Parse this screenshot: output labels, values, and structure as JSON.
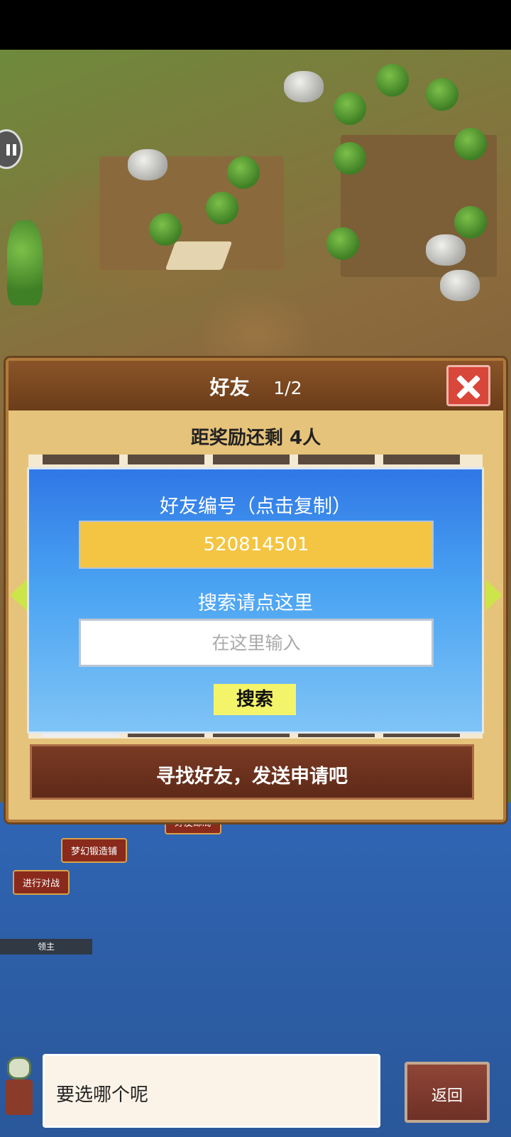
{
  "panel": {
    "title": "好友",
    "page": "1/2",
    "reward_remaining": "距奖励还剩 4人",
    "find_label": "寻找好友，发送申请吧"
  },
  "search": {
    "id_label": "好友编号（点击复制）",
    "friend_id": "520814501",
    "hint": "搜索请点这里",
    "placeholder": "在这里输入",
    "button": "搜索"
  },
  "map": {
    "labels": [
      "梦幻锻造铺",
      "进行对战",
      "好友邮局"
    ],
    "lord": "领主"
  },
  "dialog": {
    "text": "要选哪个呢",
    "back": "返回"
  }
}
